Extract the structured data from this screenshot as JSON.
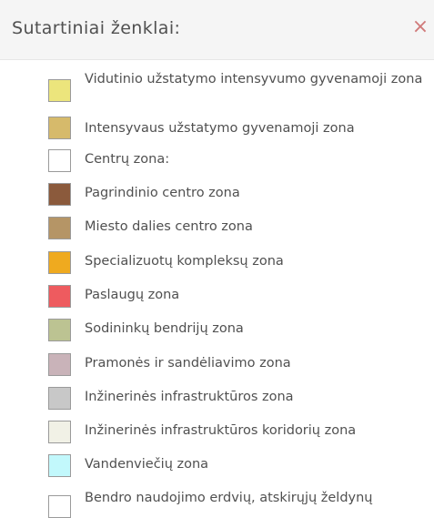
{
  "header": {
    "title": "Sutartiniai ženklai:",
    "close_glyph": "×",
    "close_icon": "close-icon"
  },
  "legend": {
    "items": [
      {
        "label": "Vidutinio užstatymo intensyvumo gyvenamoji zona",
        "color": "#ece57c"
      },
      {
        "label": "Intensyvaus užstatymo gyvenamoji zona",
        "color": "#d6ba6b"
      },
      {
        "label": "Centrų zona:",
        "color": "#ffffff"
      },
      {
        "label": "Pagrindinio centro zona",
        "color": "#8b5a3c"
      },
      {
        "label": "Miesto dalies centro zona",
        "color": "#b59566"
      },
      {
        "label": "Specializuotų kompleksų zona",
        "color": "#efaa1f"
      },
      {
        "label": "Paslaugų zona",
        "color": "#ee5b5f"
      },
      {
        "label": "Sodininkų bendrijų zona",
        "color": "#bcc392"
      },
      {
        "label": "Pramonės ir sandėliavimo zona",
        "color": "#c9b3b9"
      },
      {
        "label": "Inžinerinės infrastruktūros zona",
        "color": "#c8c8c8"
      },
      {
        "label": "Inžinerinės infrastruktūros koridorių zona",
        "color": "#f1f1e6"
      },
      {
        "label": "Vandenviečių zona",
        "color": "#c2f8fc"
      },
      {
        "label": "Bendro naudojimo erdvių, atskirųjų želdynų",
        "color": "#ffffff"
      }
    ]
  }
}
